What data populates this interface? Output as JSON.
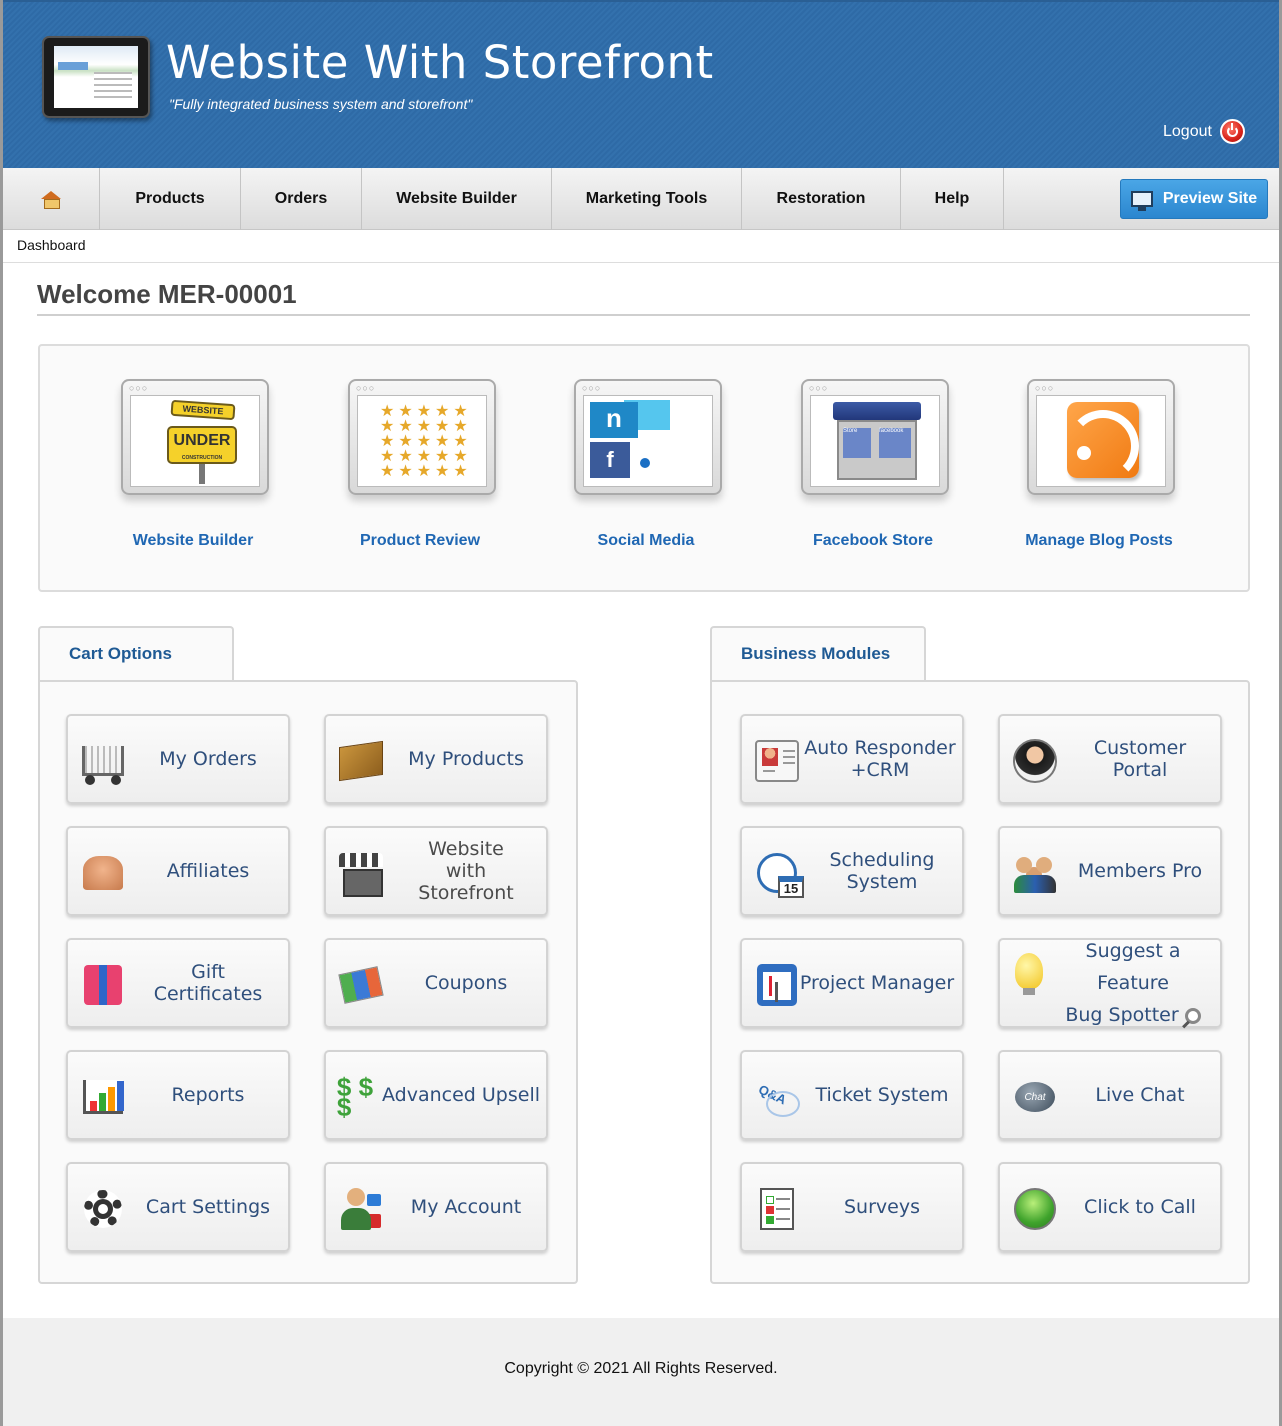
{
  "header": {
    "title": "Website With Storefront",
    "tagline": "\"Fully integrated business system and storefront\"",
    "logout_label": "Logout"
  },
  "nav": {
    "items": [
      "Products",
      "Orders",
      "Website Builder",
      "Marketing Tools",
      "Restoration",
      "Help"
    ],
    "preview_label": "Preview Site"
  },
  "breadcrumb": "Dashboard",
  "welcome": "Welcome MER-00001",
  "quick_links": [
    {
      "label": "Website Builder",
      "icon": "under-construction-icon"
    },
    {
      "label": "Product Review",
      "icon": "star-rating-icon"
    },
    {
      "label": "Social Media",
      "icon": "social-media-icon"
    },
    {
      "label": "Facebook Store",
      "icon": "facebook-store-icon"
    },
    {
      "label": "Manage Blog Posts",
      "icon": "rss-icon"
    }
  ],
  "quick_art": {
    "sign_top": "WEBSITE",
    "sign_main": "UNDER",
    "sign_sub": "CONSTRUCTION",
    "store_left": "Store",
    "store_right": "facebook"
  },
  "cart_options": {
    "tab_label": "Cart Options",
    "items": [
      {
        "label": "My Orders",
        "icon": "cart-icon"
      },
      {
        "label": "My Products",
        "icon": "box-icon"
      },
      {
        "label": "Affiliates",
        "icon": "handshake-icon"
      },
      {
        "label": "Website with Storefront",
        "icon": "storefront-icon"
      },
      {
        "label": "Gift Certificates",
        "icon": "gift-icon"
      },
      {
        "label": "Coupons",
        "icon": "coupon-icon"
      },
      {
        "label": "Reports",
        "icon": "bar-chart-icon"
      },
      {
        "label": "Advanced Upsell",
        "icon": "dollar-icon"
      },
      {
        "label": "Cart Settings",
        "icon": "gear-icon"
      },
      {
        "label": "My Account",
        "icon": "user-lock-icon"
      }
    ]
  },
  "business_modules": {
    "tab_label": "Business Modules",
    "items": [
      {
        "label": "Auto Responder +CRM",
        "icon": "contact-card-icon"
      },
      {
        "label": "Customer Portal",
        "icon": "customer-portal-icon"
      },
      {
        "label": "Scheduling System",
        "icon": "clock-calendar-icon",
        "badge": "15"
      },
      {
        "label": "Members Pro",
        "icon": "members-icon"
      },
      {
        "label": "Project Manager",
        "icon": "project-icon"
      },
      {
        "label": "Suggest a Feature",
        "label2": "Bug Spotter",
        "icon": "lightbulb-icon"
      },
      {
        "label": "Ticket System",
        "icon": "qa-icon"
      },
      {
        "label": "Live Chat",
        "icon": "chat-bubble-icon",
        "badge": "Chat"
      },
      {
        "label": "Surveys",
        "icon": "survey-icon"
      },
      {
        "label": "Click to Call",
        "icon": "phone-icon"
      }
    ]
  },
  "footer": {
    "copyright": "Copyright © 2021 All Rights Reserved."
  }
}
